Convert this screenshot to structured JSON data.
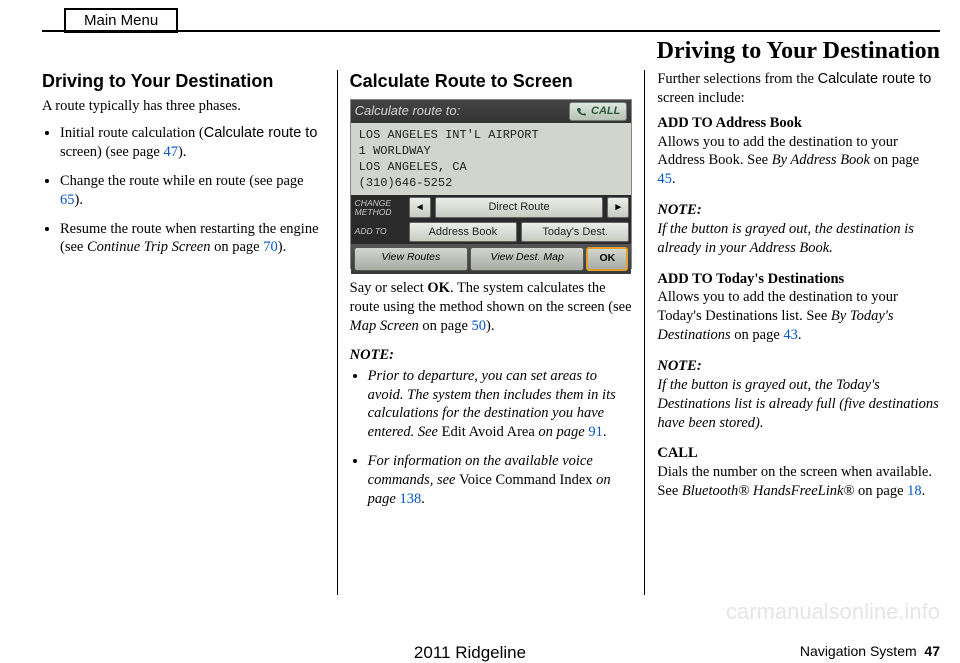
{
  "main_menu_label": "Main Menu",
  "page_header": "Driving to Your Destination",
  "col1": {
    "heading": "Driving to Your Destination",
    "intro": "A route typically has three phases.",
    "item1_a": "Initial route calculation (",
    "item1_sans": "Calculate route to",
    "item1_b": " screen) (see page ",
    "item1_link": "47",
    "item1_c": ").",
    "item2_a": "Change the route while en route (see page ",
    "item2_link": "65",
    "item2_b": ").",
    "item3_a": "Resume the route when restarting the engine (see ",
    "item3_i": "Continue Trip Screen",
    "item3_b": " on page ",
    "item3_link": "70",
    "item3_c": ")."
  },
  "col2": {
    "heading": "Calculate Route to Screen",
    "ss": {
      "title": "Calculate route to:",
      "call": "CALL",
      "line1": "LOS ANGELES INT'L AIRPORT",
      "line2": "1 WORLDWAY",
      "line3": "LOS ANGELES, CA",
      "line4": "(310)646-5252",
      "change_label_top": "CHANGE",
      "change_label_bot": "METHOD",
      "direct_route": "Direct Route",
      "addto_label": "ADD TO",
      "addr_book": "Address Book",
      "todays_dest": "Today's Dest.",
      "view_routes": "View Routes",
      "view_dest_map": "View Dest. Map",
      "ok": "OK"
    },
    "p1_a": "Say or select ",
    "p1_b": "OK",
    "p1_c": ". The system calculates the route using the method shown on the screen (see ",
    "p1_i": "Map Screen",
    "p1_d": " on page ",
    "p1_link": "50",
    "p1_e": ").",
    "note_label": "NOTE:",
    "n1_a": "Prior to departure, you can set areas to avoid. The system then includes them in its calculations for the destination you have entered. See ",
    "n1_r": "Edit Avoid Area",
    "n1_b": " on page ",
    "n1_link": "91",
    "n1_c": ".",
    "n2_a": "For information on the available voice commands, see ",
    "n2_r": "Voice Command Index",
    "n2_b": " on page ",
    "n2_link": "138",
    "n2_c": "."
  },
  "col3": {
    "intro_a": "Further selections from the ",
    "intro_sans": "Calculate route to",
    "intro_b": " screen include:",
    "ab_title": "ADD TO Address Book",
    "ab_a": "Allows you to add the destination to your Address Book. See ",
    "ab_i": "By Address Book",
    "ab_b": " on page ",
    "ab_link": "45",
    "ab_c": ".",
    "note_label": "NOTE:",
    "ab_note": "If the button is grayed out, the destination is already in your Address Book.",
    "td_title": "ADD TO Today's Destinations",
    "td_a": "Allows you to add the destination to your Today's Destinations list. See ",
    "td_i": "By Today's Destinations",
    "td_b": " on page ",
    "td_link": "43",
    "td_c": ".",
    "td_note": "If the button is grayed out, the Today's Destinations list is already full (five destinations have been stored).",
    "call_title": "CALL",
    "call_a": "Dials the number on the screen when available. See ",
    "call_i": "Bluetooth® HandsFreeLink®",
    "call_b": " on page ",
    "call_link": "18",
    "call_c": "."
  },
  "footer": {
    "vehicle": "2011 Ridgeline",
    "section": "Navigation System",
    "page": "47"
  },
  "watermark": "carmanualsonline.info"
}
